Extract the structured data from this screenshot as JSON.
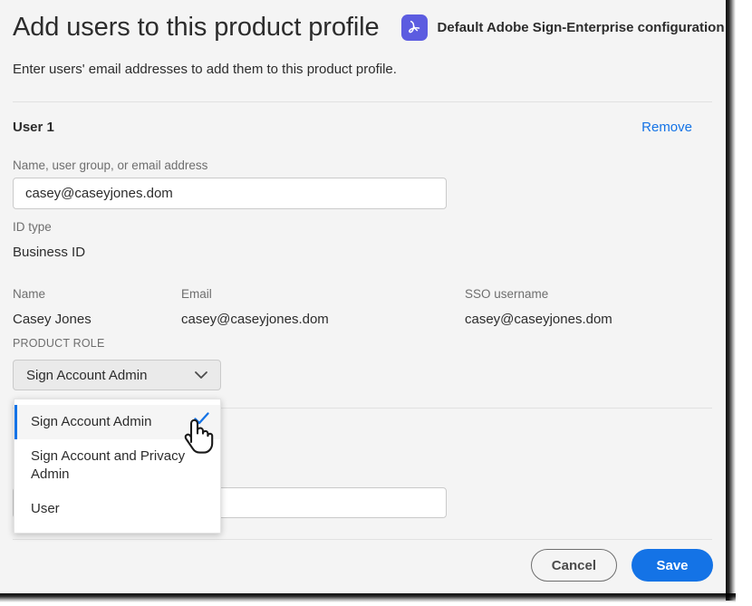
{
  "header": {
    "title": "Add users to this product profile",
    "profile_icon": "adobe-sign-icon",
    "profile_name": "Default Adobe Sign-Enterprise configuration",
    "icon_color": "#5C5CE0"
  },
  "subtitle": "Enter users' email addresses to add them to this product profile.",
  "user_section": {
    "heading": "User 1",
    "remove_label": "Remove",
    "email_field": {
      "label": "Name, user group, or email address",
      "value": "casey@caseyjones.dom",
      "placeholder": ""
    },
    "id_type": {
      "label": "ID type",
      "value": "Business ID"
    },
    "details": [
      {
        "label": "Name",
        "value": "Casey Jones"
      },
      {
        "label": "Email",
        "value": "casey@caseyjones.dom"
      },
      {
        "label": "SSO username",
        "value": "casey@caseyjones.dom"
      }
    ],
    "product_role": {
      "label": "PRODUCT ROLE",
      "selected": "Sign Account Admin",
      "expanded": true,
      "options": [
        {
          "label": "Sign Account Admin",
          "selected": true
        },
        {
          "label": "Sign Account and Privacy Admin",
          "selected": false
        },
        {
          "label": "User",
          "selected": false
        }
      ]
    }
  },
  "footer": {
    "cancel_label": "Cancel",
    "save_label": "Save",
    "save_color": "#1473E6"
  },
  "colors": {
    "accent_blue": "#1473E6",
    "link_blue": "#1473E6",
    "page_background": "#f4f4f4",
    "text_primary": "#2c2c2c",
    "text_secondary": "#6e6e6e"
  }
}
